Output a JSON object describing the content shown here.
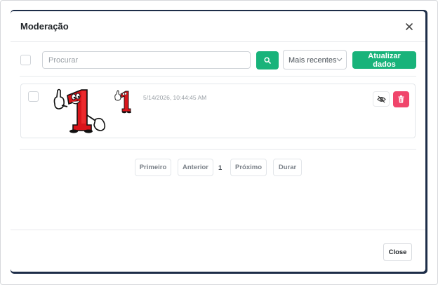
{
  "modal": {
    "title": "Moderação",
    "close_icon": "close-icon"
  },
  "toolbar": {
    "search_placeholder": "Procurar",
    "search_icon": "search-icon",
    "sort_selected": "Mais recentes",
    "sort_icon": "chevron-down-icon",
    "refresh_label": "Atualizar dados"
  },
  "items": [
    {
      "timestamp": "5/14/2026, 10:44:45 AM",
      "sticker": "number-one-mascot",
      "hide_icon": "eye-off-icon",
      "delete_icon": "trash-icon"
    }
  ],
  "pagination": {
    "first": "Primeiro",
    "previous": "Anterior",
    "current": "1",
    "next": "Próximo",
    "duration": "Durar"
  },
  "footer": {
    "close_label": "Close"
  },
  "colors": {
    "primary": "#18b37a",
    "danger": "#f0456b",
    "backdrop": "#1d2d48"
  }
}
